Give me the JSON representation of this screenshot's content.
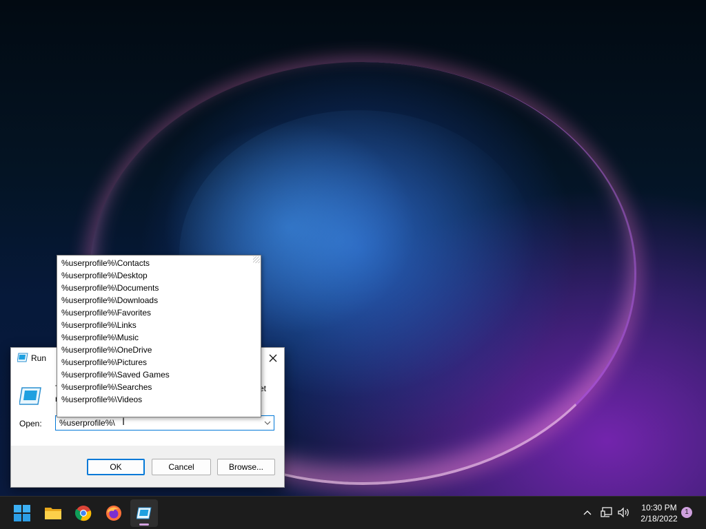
{
  "run_dialog": {
    "title": "Run",
    "description_left": "T\nr",
    "description_right": "et",
    "open_label": "Open:",
    "input_value": "%userprofile%\\",
    "buttons": {
      "ok": "OK",
      "cancel": "Cancel",
      "browse": "Browse..."
    }
  },
  "autocomplete": {
    "items": [
      "%userprofile%\\Contacts",
      "%userprofile%\\Desktop",
      "%userprofile%\\Documents",
      "%userprofile%\\Downloads",
      "%userprofile%\\Favorites",
      "%userprofile%\\Links",
      "%userprofile%\\Music",
      "%userprofile%\\OneDrive",
      "%userprofile%\\Pictures",
      "%userprofile%\\Saved Games",
      "%userprofile%\\Searches",
      "%userprofile%\\Videos"
    ]
  },
  "taskbar": {
    "pinned": [
      "start-icon",
      "file-explorer-icon",
      "chrome-icon",
      "firefox-icon",
      "run-icon"
    ],
    "active_app": "run-icon",
    "clock_time": "10:30 PM",
    "clock_date": "2/18/2022",
    "notification_count": "1",
    "accent_color": "#d4a3e0"
  }
}
